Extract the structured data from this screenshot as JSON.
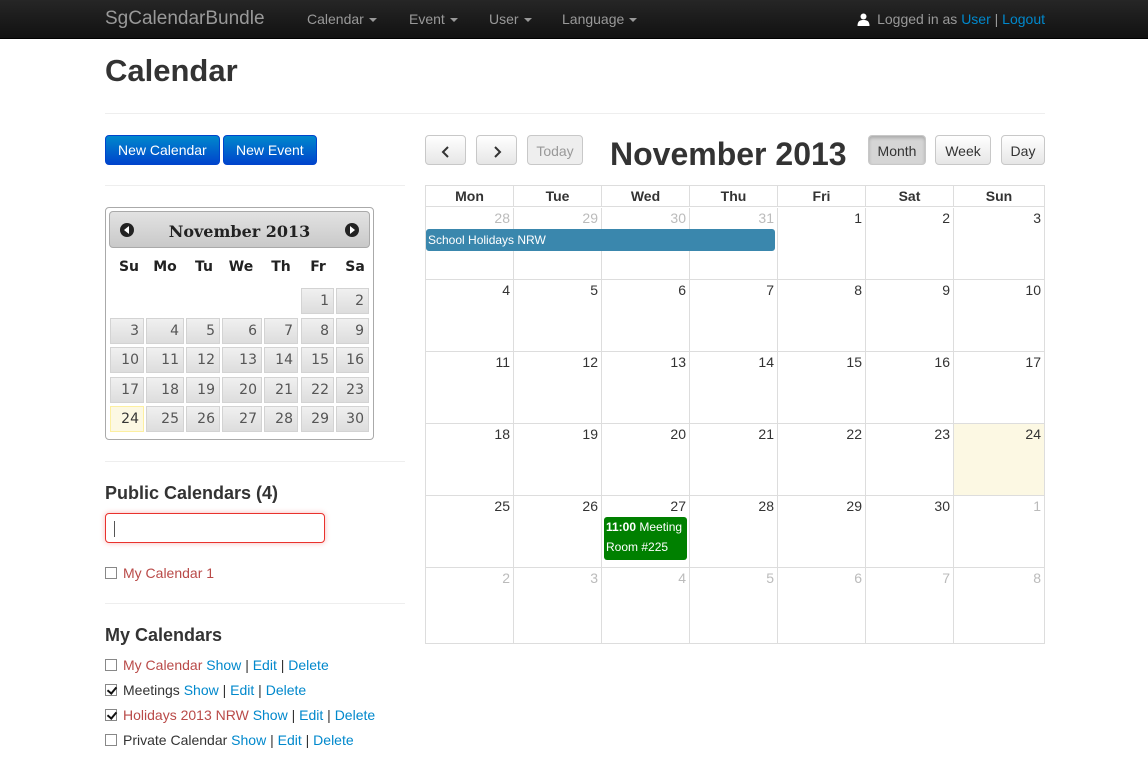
{
  "navbar": {
    "brand": "SgCalendarBundle",
    "menus": [
      "Calendar",
      "Event",
      "User",
      "Language"
    ],
    "logged_in_text": "Logged in as",
    "user_link": "User",
    "divider": "|",
    "logout_link": "Logout"
  },
  "page": {
    "title": "Calendar"
  },
  "actions": {
    "new_calendar": "New Calendar",
    "new_event": "New Event"
  },
  "datepicker": {
    "title": "November 2013",
    "weekdays": [
      "Su",
      "Mo",
      "Tu",
      "We",
      "Th",
      "Fr",
      "Sa"
    ],
    "days": [
      "1",
      "2",
      "3",
      "4",
      "5",
      "6",
      "7",
      "8",
      "9",
      "10",
      "11",
      "12",
      "13",
      "14",
      "15",
      "16",
      "17",
      "18",
      "19",
      "20",
      "21",
      "22",
      "23",
      "24",
      "25",
      "26",
      "27",
      "28",
      "29",
      "30"
    ],
    "today": "24"
  },
  "public_calendars": {
    "title": "Public Calendars (4)",
    "search_value": "",
    "items": [
      {
        "name": "My Calendar 1",
        "checked": false
      }
    ]
  },
  "my_calendars": {
    "title": "My Calendars",
    "items": [
      {
        "name": "My Calendar",
        "checked": false,
        "color": "#b94a48"
      },
      {
        "name": "Meetings",
        "checked": true,
        "color": "#333333"
      },
      {
        "name": "Holidays 2013 NRW",
        "checked": true,
        "color": "#b94a48"
      },
      {
        "name": "Private Calendar",
        "checked": false,
        "color": "#333333"
      }
    ],
    "actions": {
      "show": "Show",
      "edit": "Edit",
      "delete": "Delete",
      "separator": "|"
    }
  },
  "calendar": {
    "title": "November 2013",
    "buttons": {
      "today": "Today",
      "month": "Month",
      "week": "Week",
      "day": "Day"
    },
    "active_view": "Month",
    "weekdays": [
      "Mon",
      "Tue",
      "Wed",
      "Thu",
      "Fri",
      "Sat",
      "Sun"
    ],
    "weeks": [
      [
        "28",
        "29",
        "30",
        "31",
        "1",
        "2",
        "3"
      ],
      [
        "4",
        "5",
        "6",
        "7",
        "8",
        "9",
        "10"
      ],
      [
        "11",
        "12",
        "13",
        "14",
        "15",
        "16",
        "17"
      ],
      [
        "18",
        "19",
        "20",
        "21",
        "22",
        "23",
        "24"
      ],
      [
        "25",
        "26",
        "27",
        "28",
        "29",
        "30",
        "1"
      ],
      [
        "2",
        "3",
        "4",
        "5",
        "6",
        "7",
        "8"
      ]
    ],
    "today": "24",
    "events": [
      {
        "title": "School Holidays NRW",
        "color": "#3a87ad"
      },
      {
        "time": "11:00",
        "title": "Meeting Room #225",
        "color": "#008000"
      }
    ]
  }
}
